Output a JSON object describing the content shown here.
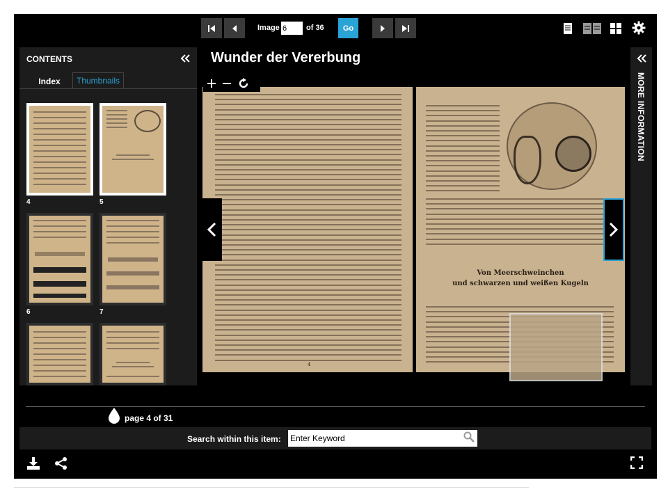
{
  "toolbar": {
    "image_label": "Image",
    "image_value": "6",
    "image_of": "of 36",
    "go_label": "Go",
    "icons": [
      "first-page-icon",
      "prev-page-icon",
      "next-page-icon",
      "last-page-icon",
      "single-page-view-icon",
      "two-page-view-icon",
      "gallery-view-icon",
      "settings-icon"
    ]
  },
  "contents": {
    "title": "CONTENTS",
    "tabs": [
      {
        "label": "Index",
        "active": false
      },
      {
        "label": "Thumbnails",
        "active": true
      }
    ],
    "thumbnails": [
      {
        "number": "4",
        "selected": true
      },
      {
        "number": "5",
        "selected": true
      },
      {
        "number": "6",
        "selected": false
      },
      {
        "number": "7",
        "selected": false
      },
      {
        "number": "",
        "selected": false
      },
      {
        "number": "",
        "selected": false
      }
    ]
  },
  "book": {
    "title": "Wunder der Vererbung",
    "zoom_controls": [
      "zoom-in-icon",
      "zoom-out-icon",
      "rotate-icon"
    ],
    "right_page_heading_line1": "Von Meerschweinchen",
    "right_page_heading_line2": "und schwarzen und weißen Kugeln",
    "left_page_number": "4"
  },
  "more_info": {
    "label": "MORE INFORMATION"
  },
  "pager": {
    "text": "page 4 of 31"
  },
  "search": {
    "label": "Search within this item:",
    "placeholder": "Enter Keyword"
  },
  "colors": {
    "accent": "#2aa3d6",
    "background": "#000000",
    "panel": "#1c1c1c",
    "paper": "#c9b28f"
  }
}
